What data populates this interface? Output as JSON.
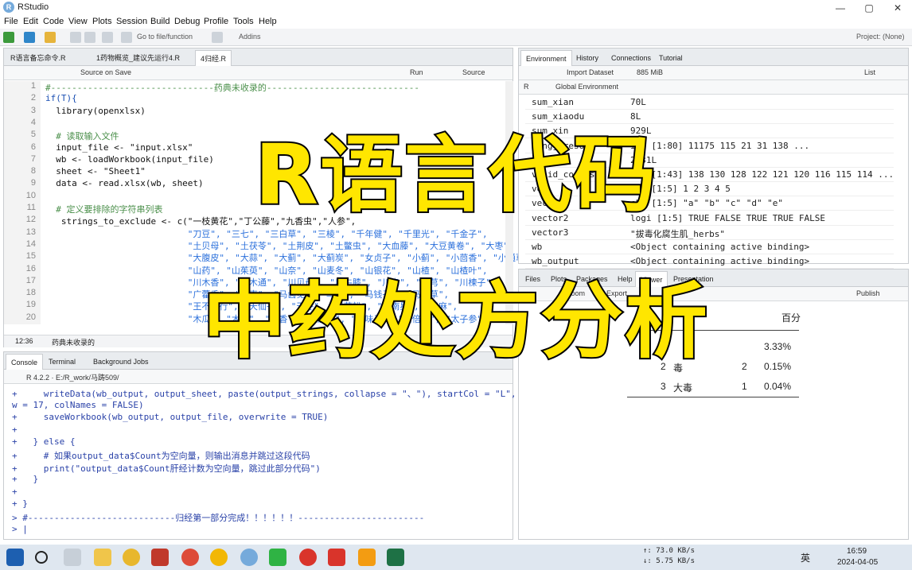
{
  "window": {
    "title": "RStudio",
    "min": "—",
    "max": "▢",
    "close": "✕"
  },
  "menu": [
    "File",
    "Edit",
    "Code",
    "View",
    "Plots",
    "Session",
    "Build",
    "Debug",
    "Profile",
    "Tools",
    "Help"
  ],
  "toolbar": {
    "goto_placeholder": "Go to file/function",
    "addins": "Addins",
    "project": "Project: (None)"
  },
  "editor": {
    "tabs": [
      "R语言备忘命令.R",
      "1药物概览_建议先运行4.R",
      "4归经.R"
    ],
    "source_on_save": "Source on Save",
    "run": "Run",
    "source": "Source",
    "status_pos": "12:36",
    "status_section": "药典未收录的",
    "lines": [
      {
        "n": "1",
        "text": "#-------------------------------药典未收录的-----------------------------",
        "cls": "cm"
      },
      {
        "n": "2",
        "text": "if(T){",
        "cls": "kw"
      },
      {
        "n": "3",
        "text": "  library(openxlsx)",
        "cls": ""
      },
      {
        "n": "4",
        "text": "",
        "cls": ""
      },
      {
        "n": "5",
        "text": "  # 读取输入文件",
        "cls": "cm"
      },
      {
        "n": "6",
        "text": "  input_file <- \"input.xlsx\"",
        "cls": ""
      },
      {
        "n": "7",
        "text": "  wb <- loadWorkbook(input_file)",
        "cls": ""
      },
      {
        "n": "8",
        "text": "  sheet <- \"Sheet1\"",
        "cls": ""
      },
      {
        "n": "9",
        "text": "  data <- read.xlsx(wb, sheet)",
        "cls": ""
      },
      {
        "n": "10",
        "text": "",
        "cls": ""
      },
      {
        "n": "11",
        "text": "  # 定义要排除的字符串列表",
        "cls": "cm"
      },
      {
        "n": "12",
        "text": "   strings_to_exclude <- c(\"一枝黄花\",\"丁公藤\",\"九香虫\",\"人参\",",
        "cls": ""
      },
      {
        "n": "13",
        "text": "                           \"刀豆\", \"三七\", \"三白草\", \"三棱\", \"千年健\", \"千里光\", \"千金子\",",
        "cls": "str"
      },
      {
        "n": "14",
        "text": "                           \"土贝母\", \"土茯苓\", \"土荆皮\", \"土鳖虫\", \"大血藤\", \"大豆黄卷\", \"大枣\",",
        "cls": "str"
      },
      {
        "n": "15",
        "text": "                           \"大腹皮\", \"大蒜\", \"大蓟\", \"大蓟炭\", \"女贞子\", \"小蓟\", \"小茴香\", \"小通草\",",
        "cls": "str"
      },
      {
        "n": "16",
        "text": "                           \"山药\", \"山茱萸\", \"山奈\", \"山麦冬\", \"山银花\", \"山楂\", \"山楂叶\",",
        "cls": "str"
      },
      {
        "n": "17",
        "text": "                           \"川木香\", \"川木通\", \"川贝母\", \"川牛膝\", \"川乌\", \"川芎\", \"川楝子\",",
        "cls": "str"
      },
      {
        "n": "18",
        "text": "                           \"广藿香\", \"广枣\", \"马齿苋\", \"马勃\", \"马钱子\", \"马鞭草\",",
        "cls": "str"
      },
      {
        "n": "19",
        "text": "                           \"王不留行\", \"天仙子\", \"天冬\", \"天花粉\", \"天南星\", \"天麻\",",
        "cls": "str"
      },
      {
        "n": "20",
        "text": "                           \"木瓜\", \"木贼\", \"木香\", \"五加皮\", \"五味子\", \"五倍子\", \"太子参\",",
        "cls": "str"
      }
    ]
  },
  "console": {
    "tabs": [
      "Console",
      "Terminal",
      "Background Jobs"
    ],
    "path": "R 4.2.2 · E:/R_work/马踌509/",
    "lines": [
      "+     writeData(wb_output, output_sheet, paste(output_strings, collapse = \"、\"), startCol = \"L\", startRo",
      "w = 17, colNames = FALSE)",
      "+     saveWorkbook(wb_output, output_file, overwrite = TRUE)",
      "+",
      "+   } else {",
      "+     # 如果output_data$Count为空向量，则输出消息并跳过这段代码",
      "+     print(\"output_data$Count肝经计数为空向量，跳过此部分代码\")",
      "+   }",
      "+",
      "+ }",
      "> #----------------------------归经第一部分完成！！！！！！------------------------",
      "> |"
    ]
  },
  "environment": {
    "tabs": [
      "Environment",
      "History",
      "Connections",
      "Tutorial"
    ],
    "import": "Import Dataset",
    "mem": "885 MiB",
    "list": "List",
    "lang": "R",
    "scope": "Global Environment",
    "rows": [
      {
        "name": "sum_xian",
        "value": "70L"
      },
      {
        "name": "sum_xiaodu",
        "value": "8L"
      },
      {
        "name": "sum_xin",
        "value": "929L"
      },
      {
        "name": "tongjiresolu",
        "value": "int [1:80] 11175 115 21 31 138 ..."
      },
      {
        "name": "total",
        "value": "2431L"
      },
      {
        "name": "valid_counts",
        "value": "int [1:43] 138 130 128 122 121 120 116 115 114 ..."
      },
      {
        "name": "vec",
        "value": "num [1:5] 1 2 3 4 5"
      },
      {
        "name": "vector",
        "value": "chr [1:5] \"a\" \"b\" \"c\" \"d\" \"e\""
      },
      {
        "name": "vector2",
        "value": "logi [1:5] TRUE FALSE TRUE TRUE FALSE"
      },
      {
        "name": "vector3",
        "value": "\"拔毒化腐生肌_herbs\""
      },
      {
        "name": "wb",
        "value": "<Object containing active binding>"
      },
      {
        "name": "wb_output",
        "value": "<Object containing active binding>"
      }
    ]
  },
  "viewer": {
    "tabs": [
      "Files",
      "Plots",
      "Packages",
      "Help",
      "Viewer",
      "Presentation"
    ],
    "zoom": "Zoom",
    "export": "Export",
    "publish": "Publish",
    "header": "百分",
    "rows": [
      {
        "idx": "1",
        "name": "",
        "count": "",
        "pct": "3.33%"
      },
      {
        "idx": "2",
        "name": "毒",
        "count": "2",
        "pct": "0.15%"
      },
      {
        "idx": "3",
        "name": "大毒",
        "count": "1",
        "pct": "0.04%"
      }
    ]
  },
  "taskbar": {
    "net_up": "↑: 73.0 KB/s",
    "net_down": "↓: 5.75 KB/s",
    "ime": "英",
    "time": "16:59",
    "date": "2024-04-05"
  },
  "overlay": {
    "line1": "R语言代码",
    "line2": "中药处方分析"
  },
  "colors": {
    "overlay_text": "#ffe600",
    "overlay_stroke": "#000000",
    "taskbar": "#dfe7f0",
    "accent": "#75aadb"
  }
}
